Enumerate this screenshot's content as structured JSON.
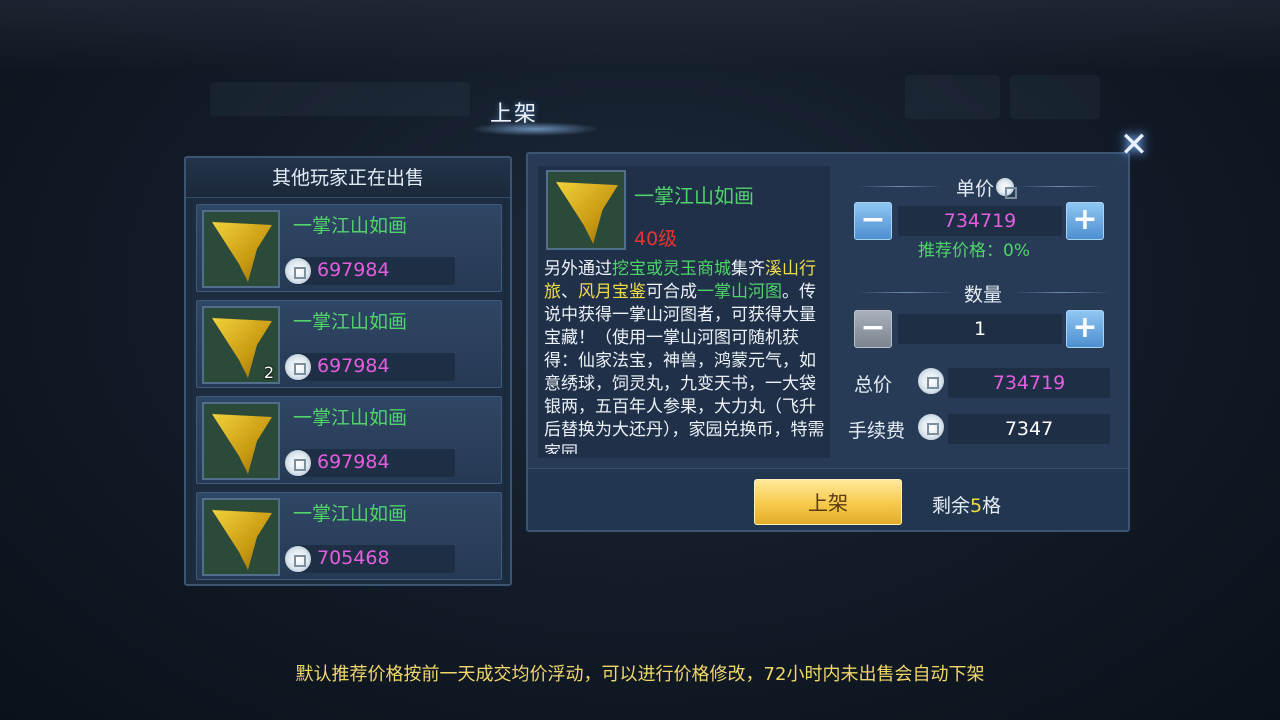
{
  "dialog": {
    "title": "上架",
    "close_icon": "close-icon"
  },
  "others_panel": {
    "header": "其他玩家正在出售",
    "listings": [
      {
        "name": "一掌江山如画",
        "price": "697984",
        "qty": ""
      },
      {
        "name": "一掌江山如画",
        "price": "697984",
        "qty": "2"
      },
      {
        "name": "一掌江山如画",
        "price": "697984",
        "qty": ""
      },
      {
        "name": "一掌江山如画",
        "price": "705468",
        "qty": ""
      }
    ]
  },
  "item": {
    "name": "一掌江山如画",
    "level": "40级",
    "desc": {
      "p1": "另外通过",
      "h1": "挖宝或灵玉商城",
      "p2": "集齐",
      "h2": "溪山行旅",
      "p3": "、",
      "h3": "风月宝鉴",
      "p4": "可合成",
      "h4": "一掌山河图",
      "p5": "。传说中获得一掌山河图者，可获得大量宝藏！（使用一掌山河图可随机获得：仙家法宝，神兽，鸿蒙元气，如意绣球，饲灵丸，九变天书，一大袋银两，五百年人参果，大力丸（飞升后替换为大还丹），家园兑换币，特需家园"
    }
  },
  "pricing": {
    "unit_price_label": "单价",
    "unit_price": "734719",
    "recommend": "推荐价格：0%",
    "quantity_label": "数量",
    "quantity": "1",
    "total_label": "总价",
    "total": "734719",
    "fee_label": "手续费",
    "fee": "7347",
    "minus": "−",
    "plus": "+"
  },
  "actions": {
    "list_button": "上架",
    "remain_prefix": "剩余",
    "remain_num": "5",
    "remain_suffix": "格"
  },
  "footer": "默认推荐价格按前一天成交均价浮动，可以进行价格修改，72小时内未出售会自动下架",
  "colors": {
    "item_name": "#4fd46a",
    "price": "#e45ee0",
    "level": "#e8352e",
    "highlight_yellow": "#f0dc4a",
    "button_gold": "#f6c94a"
  }
}
